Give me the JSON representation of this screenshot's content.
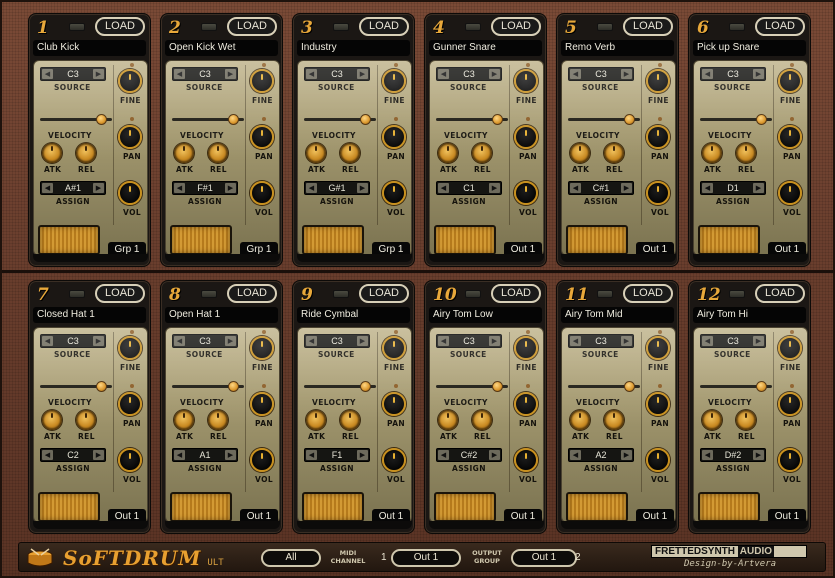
{
  "colors": {
    "accent": "#e8a83a",
    "panel": "#a59a70",
    "frame": "#6b3f2e"
  },
  "pad_common": {
    "load_label": "LOAD",
    "source_label": "SOURCE",
    "fine_label": "FINE",
    "velocity_label": "VELOCITY",
    "pan_label": "PAN",
    "atk_label": "ATK",
    "rel_label": "REL",
    "assign_label": "ASSIGN",
    "vol_label": "VOL",
    "arrow_left": "◀",
    "arrow_right": "▶"
  },
  "pads": [
    {
      "number": "1",
      "name": "Club Kick",
      "source": "C3",
      "assign": "A#1",
      "output": "Grp 1",
      "velocity": 0.85
    },
    {
      "number": "2",
      "name": "Open Kick Wet",
      "source": "C3",
      "assign": "F#1",
      "output": "Grp 1",
      "velocity": 0.85
    },
    {
      "number": "3",
      "name": "Industry",
      "source": "C3",
      "assign": "G#1",
      "output": "Grp 1",
      "velocity": 0.85
    },
    {
      "number": "4",
      "name": "Gunner Snare",
      "source": "C3",
      "assign": "C1",
      "output": "Out 1",
      "velocity": 0.85
    },
    {
      "number": "5",
      "name": "Remo Verb",
      "source": "C3",
      "assign": "C#1",
      "output": "Out 1",
      "velocity": 0.85
    },
    {
      "number": "6",
      "name": "Pick up Snare",
      "source": "C3",
      "assign": "D1",
      "output": "Out 1",
      "velocity": 0.85
    },
    {
      "number": "7",
      "name": "Closed Hat 1",
      "source": "C3",
      "assign": "C2",
      "output": "Out 1",
      "velocity": 0.85
    },
    {
      "number": "8",
      "name": "Open Hat 1",
      "source": "C3",
      "assign": "A1",
      "output": "Out 1",
      "velocity": 0.85
    },
    {
      "number": "9",
      "name": "Ride Cymbal",
      "source": "C3",
      "assign": "F1",
      "output": "Out 1",
      "velocity": 0.85
    },
    {
      "number": "10",
      "name": "Airy Tom Low",
      "source": "C3",
      "assign": "C#2",
      "output": "Out 1",
      "velocity": 0.85
    },
    {
      "number": "11",
      "name": "Airy Tom Mid",
      "source": "C3",
      "assign": "A2",
      "output": "Out 1",
      "velocity": 0.85
    },
    {
      "number": "12",
      "name": "Airy Tom Hi",
      "source": "C3",
      "assign": "D#2",
      "output": "Out 1",
      "velocity": 0.85
    }
  ],
  "bottom": {
    "logo_text": "SoFTDRUM",
    "logo_sub": "ULT",
    "midi_value": "All",
    "midi_label_1": "MIDI",
    "midi_label_2": "CHANNEL",
    "output_left_num": "1",
    "output_left_value": "Out 1",
    "output_label_1": "OUTPUT",
    "output_label_2": "GROUP",
    "output_right_value": "Out 1",
    "output_right_num": "2",
    "brand_left": "FRETTEDSYNTH",
    "brand_right": "AUDIO",
    "brand_sub": "Design-by-Artvera"
  }
}
